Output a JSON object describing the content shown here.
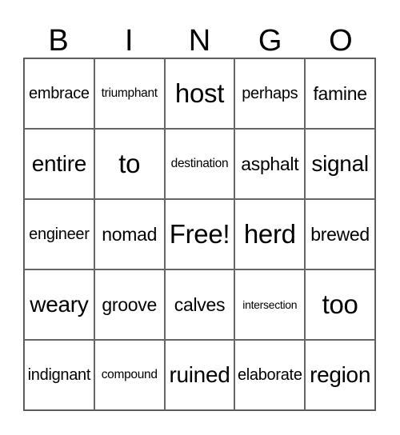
{
  "header": {
    "letters": [
      "B",
      "I",
      "N",
      "G",
      "O"
    ]
  },
  "card": {
    "cells": [
      {
        "text": "embrace",
        "size": "md"
      },
      {
        "text": "triumphant",
        "size": "sm"
      },
      {
        "text": "host",
        "size": "xxl"
      },
      {
        "text": "perhaps",
        "size": "md"
      },
      {
        "text": "famine",
        "size": "lg"
      },
      {
        "text": "entire",
        "size": "xl"
      },
      {
        "text": "to",
        "size": "xxl"
      },
      {
        "text": "destination",
        "size": "sm"
      },
      {
        "text": "asphalt",
        "size": "lg"
      },
      {
        "text": "signal",
        "size": "xl"
      },
      {
        "text": "engineer",
        "size": "md"
      },
      {
        "text": "nomad",
        "size": "lg"
      },
      {
        "text": "Free!",
        "size": "xxl"
      },
      {
        "text": "herd",
        "size": "xxl"
      },
      {
        "text": "brewed",
        "size": "lg"
      },
      {
        "text": "weary",
        "size": "xl"
      },
      {
        "text": "groove",
        "size": "lg"
      },
      {
        "text": "calves",
        "size": "lg"
      },
      {
        "text": "intersection",
        "size": "xs"
      },
      {
        "text": "too",
        "size": "xxl"
      },
      {
        "text": "indignant",
        "size": "md"
      },
      {
        "text": "compound",
        "size": "sm"
      },
      {
        "text": "ruined",
        "size": "xl"
      },
      {
        "text": "elaborate",
        "size": "md"
      },
      {
        "text": "region",
        "size": "xl"
      }
    ]
  }
}
